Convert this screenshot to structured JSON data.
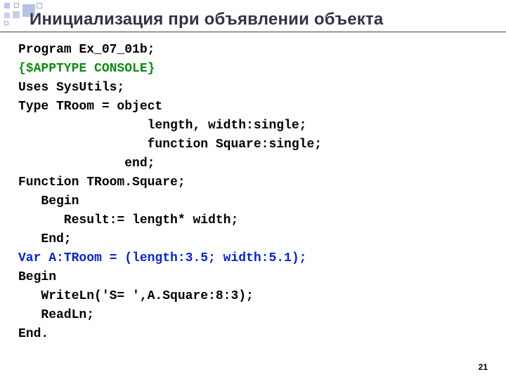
{
  "title": "Инициализация при объявлении объекта",
  "code": {
    "l1": "Program Ex_07_01b;",
    "l2": "{$APPTYPE CONSOLE}",
    "l3": "Uses SysUtils;",
    "l4": "Type TRoom = object",
    "l5": "                 length, width:single;",
    "l6": "                 function Square:single;",
    "l7": "              end;",
    "l8": "Function TRoom.Square;",
    "l9": "   Begin",
    "l10": "      Result:= length* width;",
    "l11": "   End;",
    "l12": "Var A:TRoom = (length:3.5; width:5.1);",
    "l13": "Begin",
    "l14": "   WriteLn('S= ',A.Square:8:3);",
    "l15": "   ReadLn;",
    "l16": "End."
  },
  "page_number": "21"
}
